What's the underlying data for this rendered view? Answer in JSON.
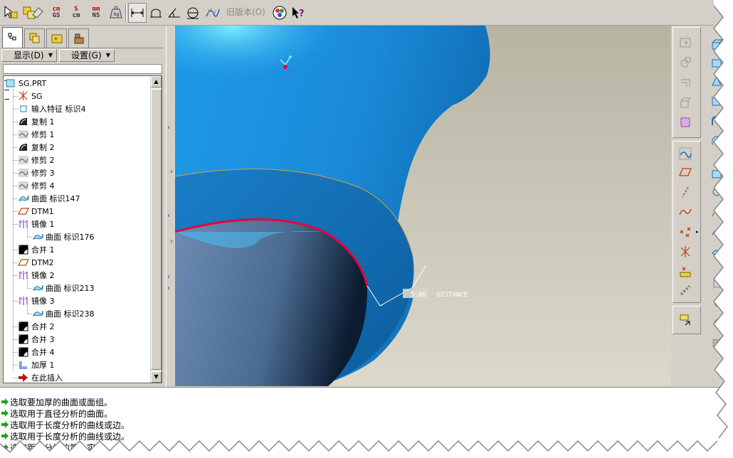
{
  "toolbar": {
    "btn_cm_gs": [
      "cm",
      "GS"
    ],
    "btn_s_cm": [
      "S",
      "cm"
    ],
    "btn_mm_ns": [
      "mm",
      "NS"
    ],
    "old_version_label": "旧版本(O)"
  },
  "panel": {
    "show_menu": "显示(D)",
    "settings_menu": "设置(G)"
  },
  "tree": {
    "items": [
      {
        "label": "SG.PRT",
        "icon": "part-icon"
      },
      {
        "label": "SG",
        "icon": "csys-icon"
      },
      {
        "label": "输入特征 标识4",
        "icon": "import-feature-icon"
      },
      {
        "label": "复制 1",
        "icon": "copy-icon"
      },
      {
        "label": "修剪 1",
        "icon": "trim-icon"
      },
      {
        "label": "复制 2",
        "icon": "copy-icon"
      },
      {
        "label": "修剪 2",
        "icon": "trim-icon"
      },
      {
        "label": "修剪 3",
        "icon": "trim-icon"
      },
      {
        "label": "修剪 4",
        "icon": "trim-icon"
      },
      {
        "label": "曲面 标识147",
        "icon": "surface-icon"
      },
      {
        "label": "DTM1",
        "icon": "datum-plane-icon"
      },
      {
        "label": "镜像 1",
        "icon": "mirror-icon"
      },
      {
        "label": "曲面 标识176",
        "icon": "surface-icon"
      },
      {
        "label": "合并 1",
        "icon": "merge-icon"
      },
      {
        "label": "DTM2",
        "icon": "datum-plane-icon"
      },
      {
        "label": "镜像 2",
        "icon": "mirror-icon"
      },
      {
        "label": "曲面 标识213",
        "icon": "surface-icon"
      },
      {
        "label": "镜像 3",
        "icon": "mirror-icon"
      },
      {
        "label": "曲面 标识238",
        "icon": "surface-icon"
      },
      {
        "label": "合并 2",
        "icon": "merge-icon"
      },
      {
        "label": "合并 3",
        "icon": "merge-icon"
      },
      {
        "label": "合并 4",
        "icon": "merge-icon"
      },
      {
        "label": "加厚 1",
        "icon": "thicken-icon"
      },
      {
        "label": "在此插入",
        "icon": "insert-here-arrow-icon"
      }
    ]
  },
  "viewport": {
    "dimension_value": "5.00",
    "dimension_label": "DISTANCE",
    "colors": {
      "surface": "#1e88d8",
      "background": "#c8c4b4",
      "selected_edge": "#e8003c"
    }
  },
  "messages": [
    "选取要加厚的曲面或面组。",
    "选取用于直径分析的曲面。",
    "选取用于长度分析的曲线或边。",
    "选取用于长度分析的曲线或边。",
    "选取距离分析的第一实体"
  ]
}
